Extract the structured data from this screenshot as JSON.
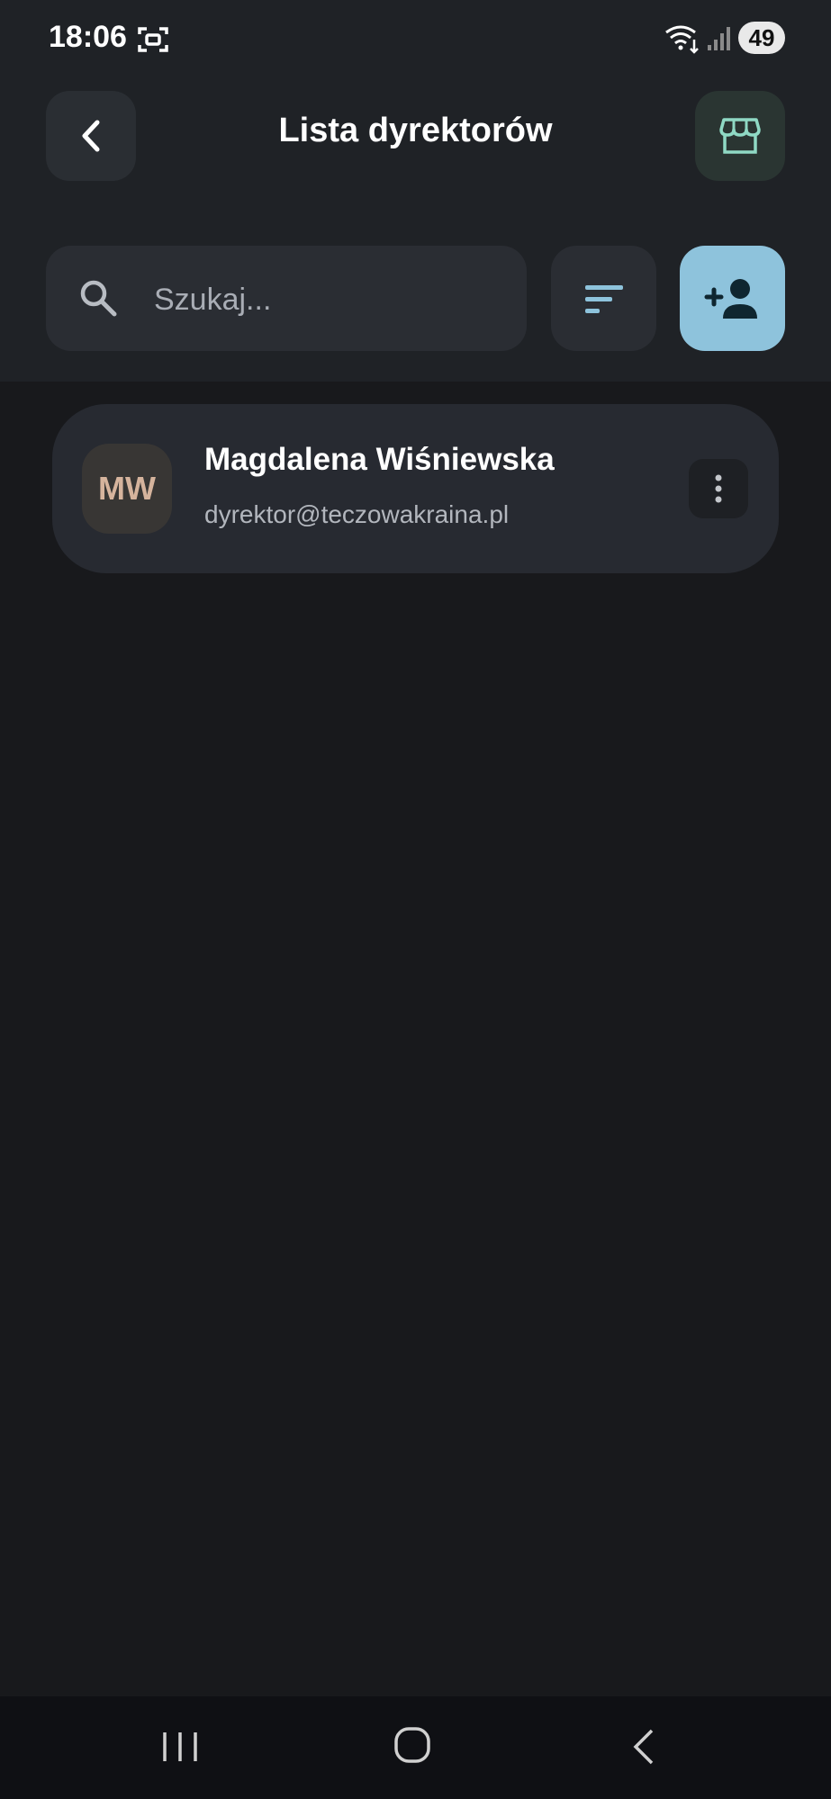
{
  "status_bar": {
    "time": "18:06",
    "battery": "49"
  },
  "header": {
    "title": "Lista dyrektorów",
    "back_icon": "chevron-left-icon",
    "store_icon": "storefront-icon"
  },
  "search": {
    "placeholder": "Szukaj...",
    "value": ""
  },
  "colors": {
    "accent": "#8ec3dc",
    "store_icon": "#8fd9c4",
    "avatar_text": "#d6b49d",
    "background": "#18191c"
  },
  "directors": [
    {
      "initials": "MW",
      "name": "Magdalena Wiśniewska",
      "email": "dyrektor@teczowakraina.pl"
    }
  ]
}
